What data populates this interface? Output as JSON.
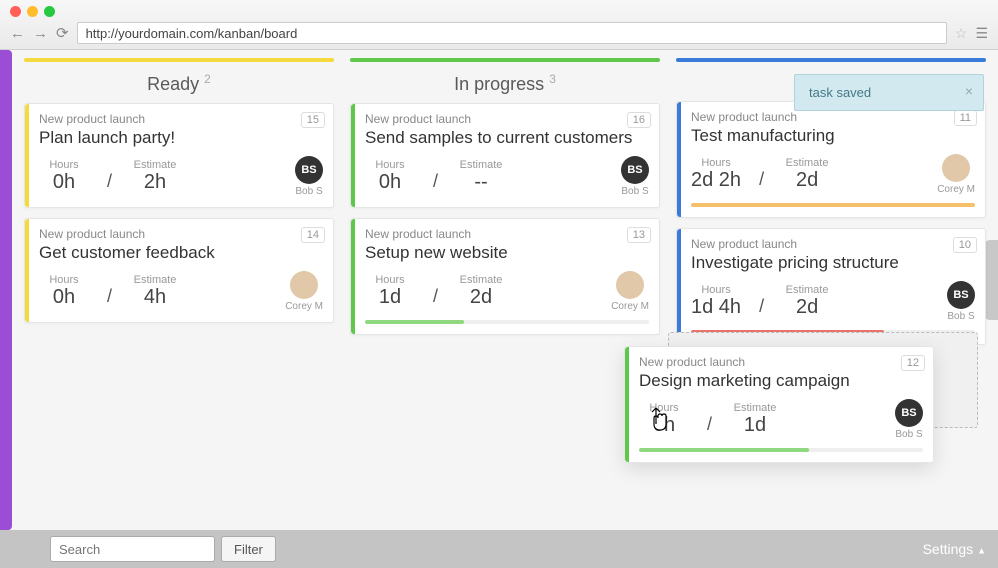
{
  "url": "http://yourdomain.com/kanban/board",
  "toast": {
    "text": "task saved"
  },
  "columns": [
    {
      "name": "Ready",
      "count": 2,
      "color": "yellow"
    },
    {
      "name": "In progress",
      "count": 3,
      "color": "green"
    },
    {
      "name": "",
      "count": null,
      "color": "blue"
    }
  ],
  "cards": {
    "ready": [
      {
        "project": "New product launch",
        "title": "Plan launch party!",
        "num": "15",
        "hours": "0h",
        "est": "2h",
        "assignee": "Bob S",
        "avatar": "BS"
      },
      {
        "project": "New product launch",
        "title": "Get customer feedback",
        "num": "14",
        "hours": "0h",
        "est": "4h",
        "assignee": "Corey M",
        "avatar": "photo"
      }
    ],
    "inprogress": [
      {
        "project": "New product launch",
        "title": "Send samples to current customers",
        "num": "16",
        "hours": "0h",
        "est": "--",
        "assignee": "Bob S",
        "avatar": "BS"
      },
      {
        "project": "New product launch",
        "title": "Setup new website",
        "num": "13",
        "hours": "1d",
        "est": "2d",
        "assignee": "Corey M",
        "avatar": "photo",
        "progress": 35,
        "progressColor": "green"
      }
    ],
    "col3": [
      {
        "project": "New product launch",
        "title": "Test manufacturing",
        "num": "11",
        "hours": "2d 2h",
        "est": "2d",
        "assignee": "Corey M",
        "avatar": "photo",
        "progress": 100,
        "progressColor": "orange"
      },
      {
        "project": "New product launch",
        "title": "Investigate pricing structure",
        "num": "10",
        "hours": "1d 4h",
        "est": "2d",
        "assignee": "Bob S",
        "avatar": "BS",
        "progress": 68,
        "progressColor": "red"
      }
    ],
    "dragging": {
      "project": "New product launch",
      "title": "Design marketing campaign",
      "num": "12",
      "hours": "6h",
      "est": "1d",
      "assignee": "Bob S",
      "avatar": "BS",
      "progress": 60,
      "progressColor": "green"
    }
  },
  "labels": {
    "hours": "Hours",
    "estimate": "Estimate",
    "searchPlaceholder": "Search",
    "filter": "Filter",
    "settings": "Settings"
  }
}
